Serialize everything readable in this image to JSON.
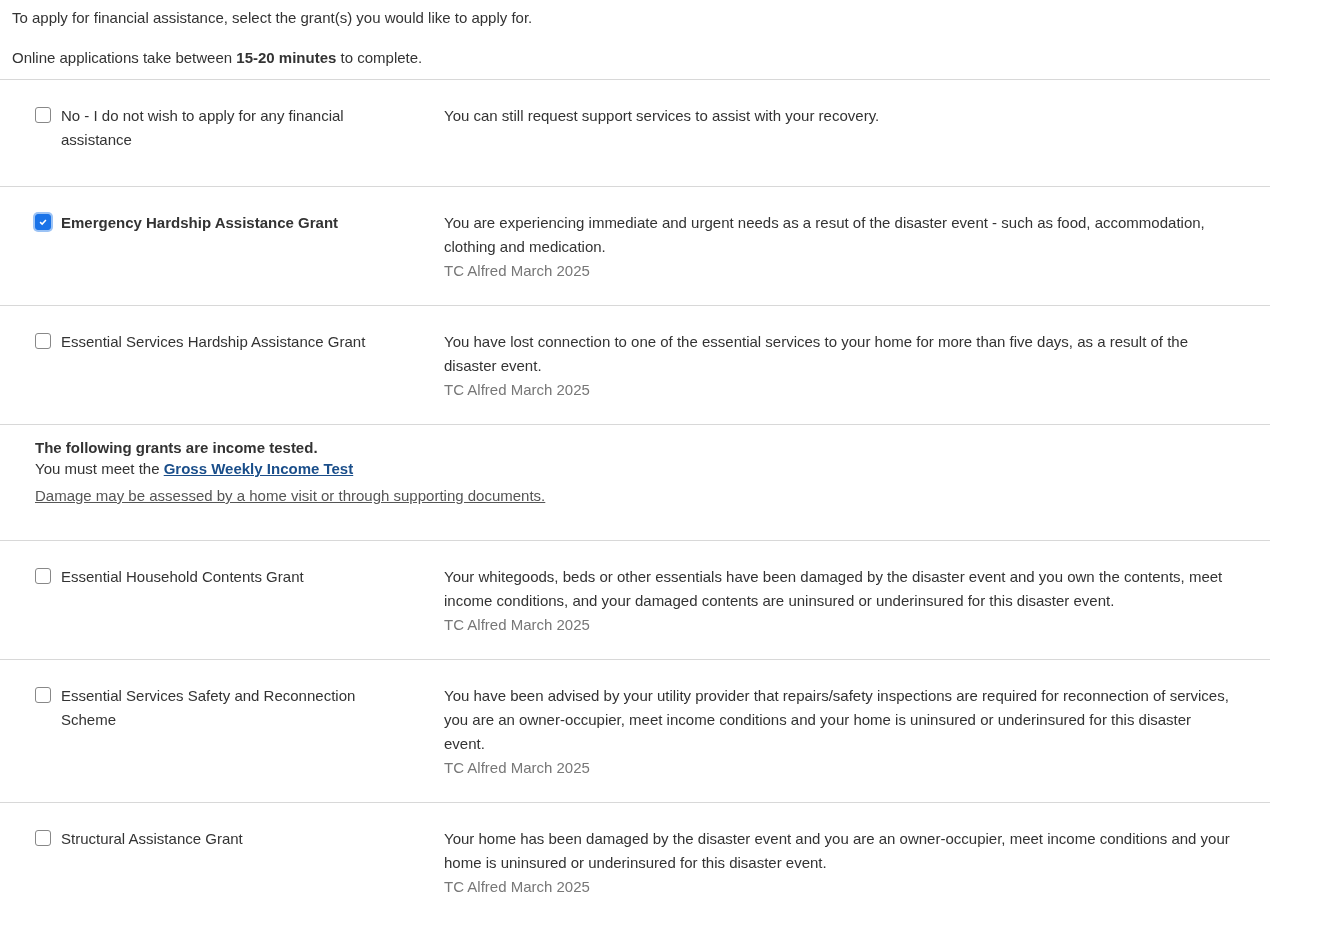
{
  "intro": [
    "To apply for financial assistance, select the grant(s) you would like to apply for.",
    "Online applications take between **15-20 minutes** to complete."
  ],
  "items": [
    {
      "kind": "grant",
      "title": "No - I do not wish to apply for any financial assistance",
      "checked": false,
      "description": "You can still request support services to assist with your recovery."
    },
    {
      "kind": "grant",
      "title": "Emergency Hardship Assistance Grant",
      "checked": true,
      "description": "You are experiencing immediate and urgent needs as a resut of the disaster event - such as food, accommodation, clothing and medication.",
      "event": "TC Alfred March 2025"
    },
    {
      "kind": "grant",
      "title": "Essential Services Hardship Assistance Grant",
      "checked": false,
      "description": "You have lost connection to one of the essential services to your home for more than five days, as a result of the disaster event.",
      "event": "TC Alfred March 2025"
    },
    {
      "kind": "section",
      "heading": "The following grants are income tested.",
      "note": "You must meet the",
      "link": "Gross Weekly Income Test",
      "footnote": "Damage may be assessed by a home visit or through supporting documents."
    },
    {
      "kind": "grant",
      "title": "Essential Household Contents Grant",
      "checked": false,
      "description": "Your whitegoods, beds or other essentials have been damaged by the disaster event and you own the contents, meet income conditions, and your damaged contents are uninsured or underinsured for this disaster event.",
      "event": "TC Alfred March 2025"
    },
    {
      "kind": "grant",
      "title": "Essential Services Safety and Reconnection Scheme",
      "checked": false,
      "description": "You have been advised by your utility provider that repairs/safety inspections are required for reconnection of services, you are an owner-occupier, meet income conditions and your home is uninsured or underinsured for this disaster event.",
      "event": "TC Alfred March 2025"
    },
    {
      "kind": "grant",
      "title": "Structural Assistance Grant",
      "checked": false,
      "description": "Your home has been damaged by the disaster event and you are an owner-occupier, meet income conditions and your home is uninsured or underinsured for this disaster event.",
      "event": "TC Alfred March 2025"
    }
  ]
}
